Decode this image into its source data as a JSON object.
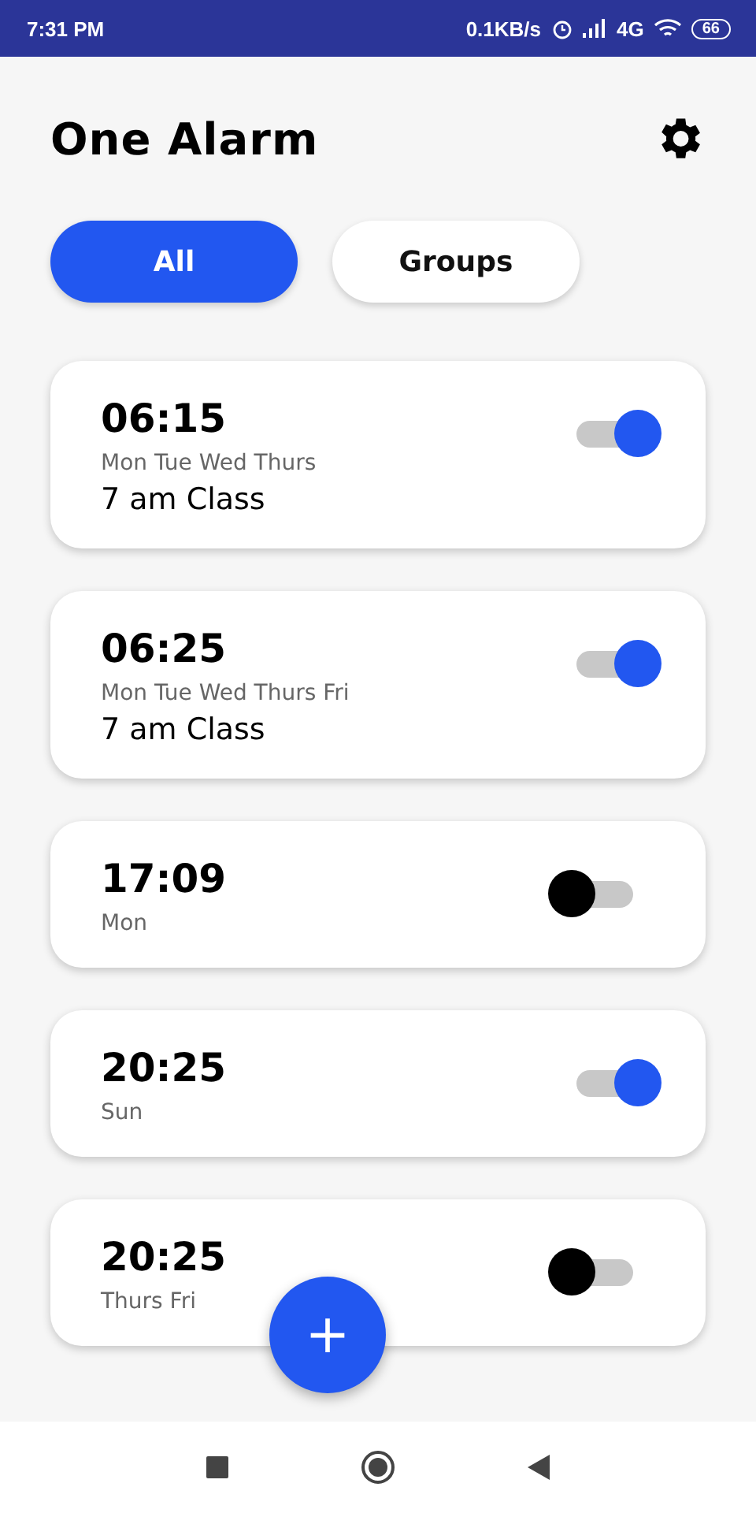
{
  "status_bar": {
    "time": "7:31 PM",
    "speed": "0.1KB/s",
    "network": "4G",
    "battery": "66"
  },
  "header": {
    "title": "One Alarm"
  },
  "tabs": [
    {
      "label": "All",
      "selected": true
    },
    {
      "label": "Groups",
      "selected": false
    }
  ],
  "alarms": [
    {
      "time": "06:15",
      "days": "Mon Tue Wed Thurs",
      "label": "7 am Class",
      "on": true
    },
    {
      "time": "06:25",
      "days": "Mon Tue Wed Thurs Fri",
      "label": "7 am Class",
      "on": true
    },
    {
      "time": "17:09",
      "days": "Mon",
      "on": false
    },
    {
      "time": "20:25",
      "days": "Sun",
      "on": true
    },
    {
      "time": "20:25",
      "days": "Thurs Fri",
      "on": false
    }
  ],
  "fab": {
    "label": "+"
  }
}
